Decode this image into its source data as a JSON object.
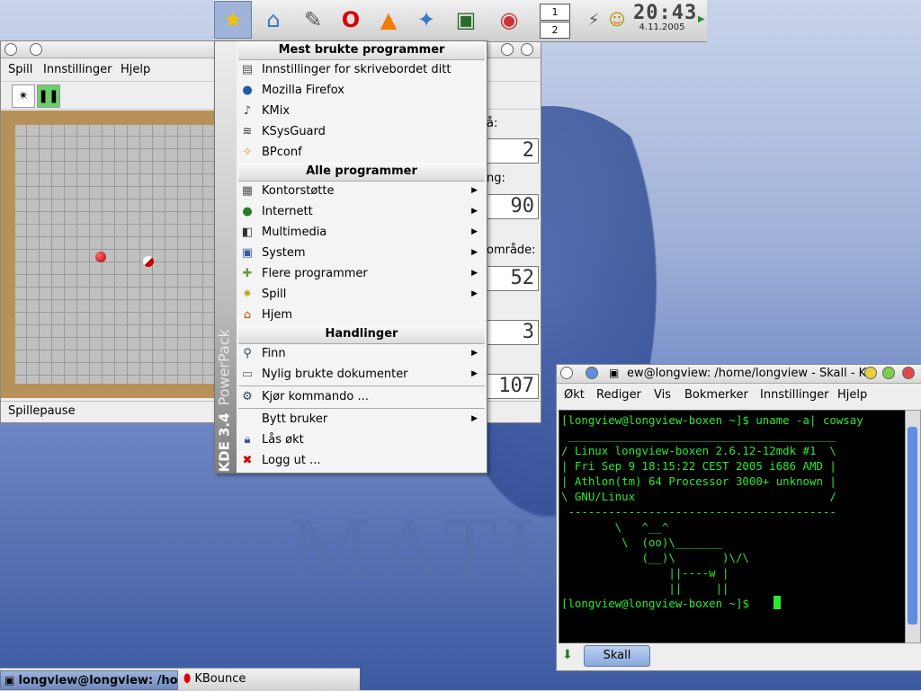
{
  "wallpaper": {
    "word": "MATU"
  },
  "top_panel": {
    "icons": [
      "kmenu-star-icon",
      "home-folder-icon",
      "text-editor-icon",
      "opera-icon",
      "vlc-cone-icon",
      "kde-control-icon",
      "monitor-icon",
      "display-settings-icon"
    ],
    "pager": {
      "desk1": "1",
      "desk2": "2"
    },
    "clock": {
      "time": "20:43",
      "date": "4.11.2005"
    }
  },
  "kbounce": {
    "menu": [
      "Spill",
      "Innstillinger",
      "Hjelp"
    ],
    "side_labels": [
      "å:",
      "ng:",
      "område:"
    ],
    "lcd_values": [
      "2",
      "90",
      "52",
      "3",
      "107"
    ],
    "status": "Spillepause"
  },
  "kmenu": {
    "side_brand": "KDE 3.4",
    "side_pack": "PowerPack",
    "sections": {
      "most_used": "Mest brukte programmer",
      "all": "Alle programmer",
      "actions": "Handlinger"
    },
    "most_used": [
      "Innstillinger for skrivebordet ditt",
      "Mozilla Firefox",
      "KMix",
      "KSysGuard",
      "BPconf"
    ],
    "all": [
      "Kontorstøtte",
      "Internett",
      "Multimedia",
      "System",
      "Flere programmer",
      "Spill",
      "Hjem"
    ],
    "actions": [
      "Finn",
      "Nylig brukte dokumenter",
      "Kjør kommando ...",
      "Bytt bruker",
      "Lås økt",
      "Logg ut ..."
    ]
  },
  "konsole": {
    "title": "ew@longview: /home/longview - Skall - K",
    "menu": [
      "Økt",
      "Rediger",
      "Vis",
      "Bokmerker",
      "Innstillinger",
      "Hjelp"
    ],
    "output": "[longview@longview-boxen ~]$ uname -a| cowsay\n ________________________________________\n/ Linux longview-boxen 2.6.12-12mdk #1  \\\n| Fri Sep 9 18:15:22 CEST 2005 i686 AMD |\n| Athlon(tm) 64 Processor 3000+ unknown |\n\\ GNU/Linux                             /\n ----------------------------------------\n        \\   ^__^\n         \\  (oo)\\_______\n            (__)\\       )\\/\\\n                ||----w |\n                ||     ||\n[longview@longview-boxen ~]$ ",
    "tab_label": "Skall"
  },
  "taskbar": {
    "tasks": [
      "longview@longview: /ho",
      "KBounce"
    ]
  }
}
